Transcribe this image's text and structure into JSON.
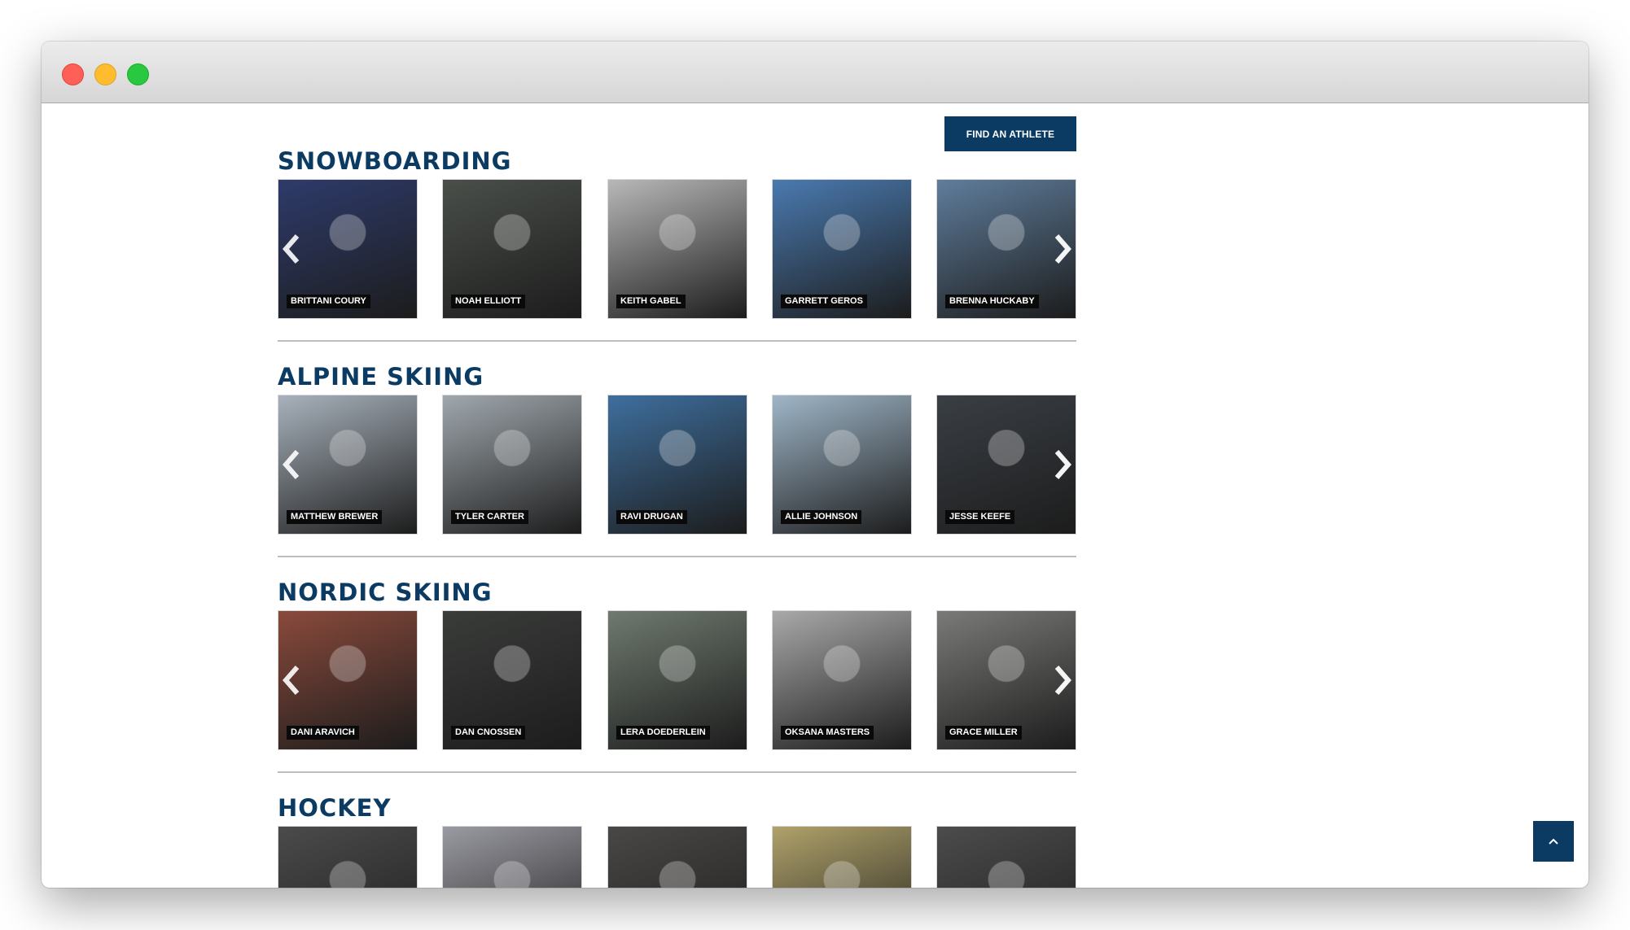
{
  "header": {
    "find_athlete_label": "FIND AN ATHLETE"
  },
  "sections": [
    {
      "title": "SNOWBOARDING",
      "athletes": [
        {
          "name": "BRITTANI COURY",
          "bg": "#2e3b6b"
        },
        {
          "name": "NOAH ELLIOTT",
          "bg": "#4a4f4a"
        },
        {
          "name": "KEITH GABEL",
          "bg": "#b8b8b8"
        },
        {
          "name": "GARRETT GEROS",
          "bg": "#4a7ab0"
        },
        {
          "name": "BRENNA HUCKABY",
          "bg": "#5f7d9c"
        }
      ]
    },
    {
      "title": "ALPINE SKIING",
      "athletes": [
        {
          "name": "MATTHEW BREWER",
          "bg": "#a8b2bc"
        },
        {
          "name": "TYLER CARTER",
          "bg": "#a0a8ae"
        },
        {
          "name": "RAVI DRUGAN",
          "bg": "#3e6f9e"
        },
        {
          "name": "ALLIE JOHNSON",
          "bg": "#9fb6c8"
        },
        {
          "name": "JESSE KEEFE",
          "bg": "#3a3f45"
        }
      ]
    },
    {
      "title": "NORDIC SKIING",
      "athletes": [
        {
          "name": "DANI ARAVICH",
          "bg": "#8a4a3c"
        },
        {
          "name": "DAN CNOSSEN",
          "bg": "#3a3c3a"
        },
        {
          "name": "LERA DOEDERLEIN",
          "bg": "#6f7a6f"
        },
        {
          "name": "OKSANA MASTERS",
          "bg": "#a9a9a9"
        },
        {
          "name": "GRACE MILLER",
          "bg": "#7a7a78"
        }
      ]
    },
    {
      "title": "HOCKEY",
      "athletes": [
        {
          "name": "",
          "bg": "#4b4b4b"
        },
        {
          "name": "",
          "bg": "#9a9aa2"
        },
        {
          "name": "",
          "bg": "#4a4846"
        },
        {
          "name": "",
          "bg": "#b0a26a"
        },
        {
          "name": "",
          "bg": "#4c4c4c"
        }
      ]
    }
  ],
  "icons": {
    "prev": "chevron-left-icon",
    "next": "chevron-right-icon",
    "back_to_top": "chevron-up-icon"
  },
  "colors": {
    "brand_navy": "#0b3a62",
    "divider": "#bdbdbd",
    "name_label_bg": "#0a0a0a"
  }
}
